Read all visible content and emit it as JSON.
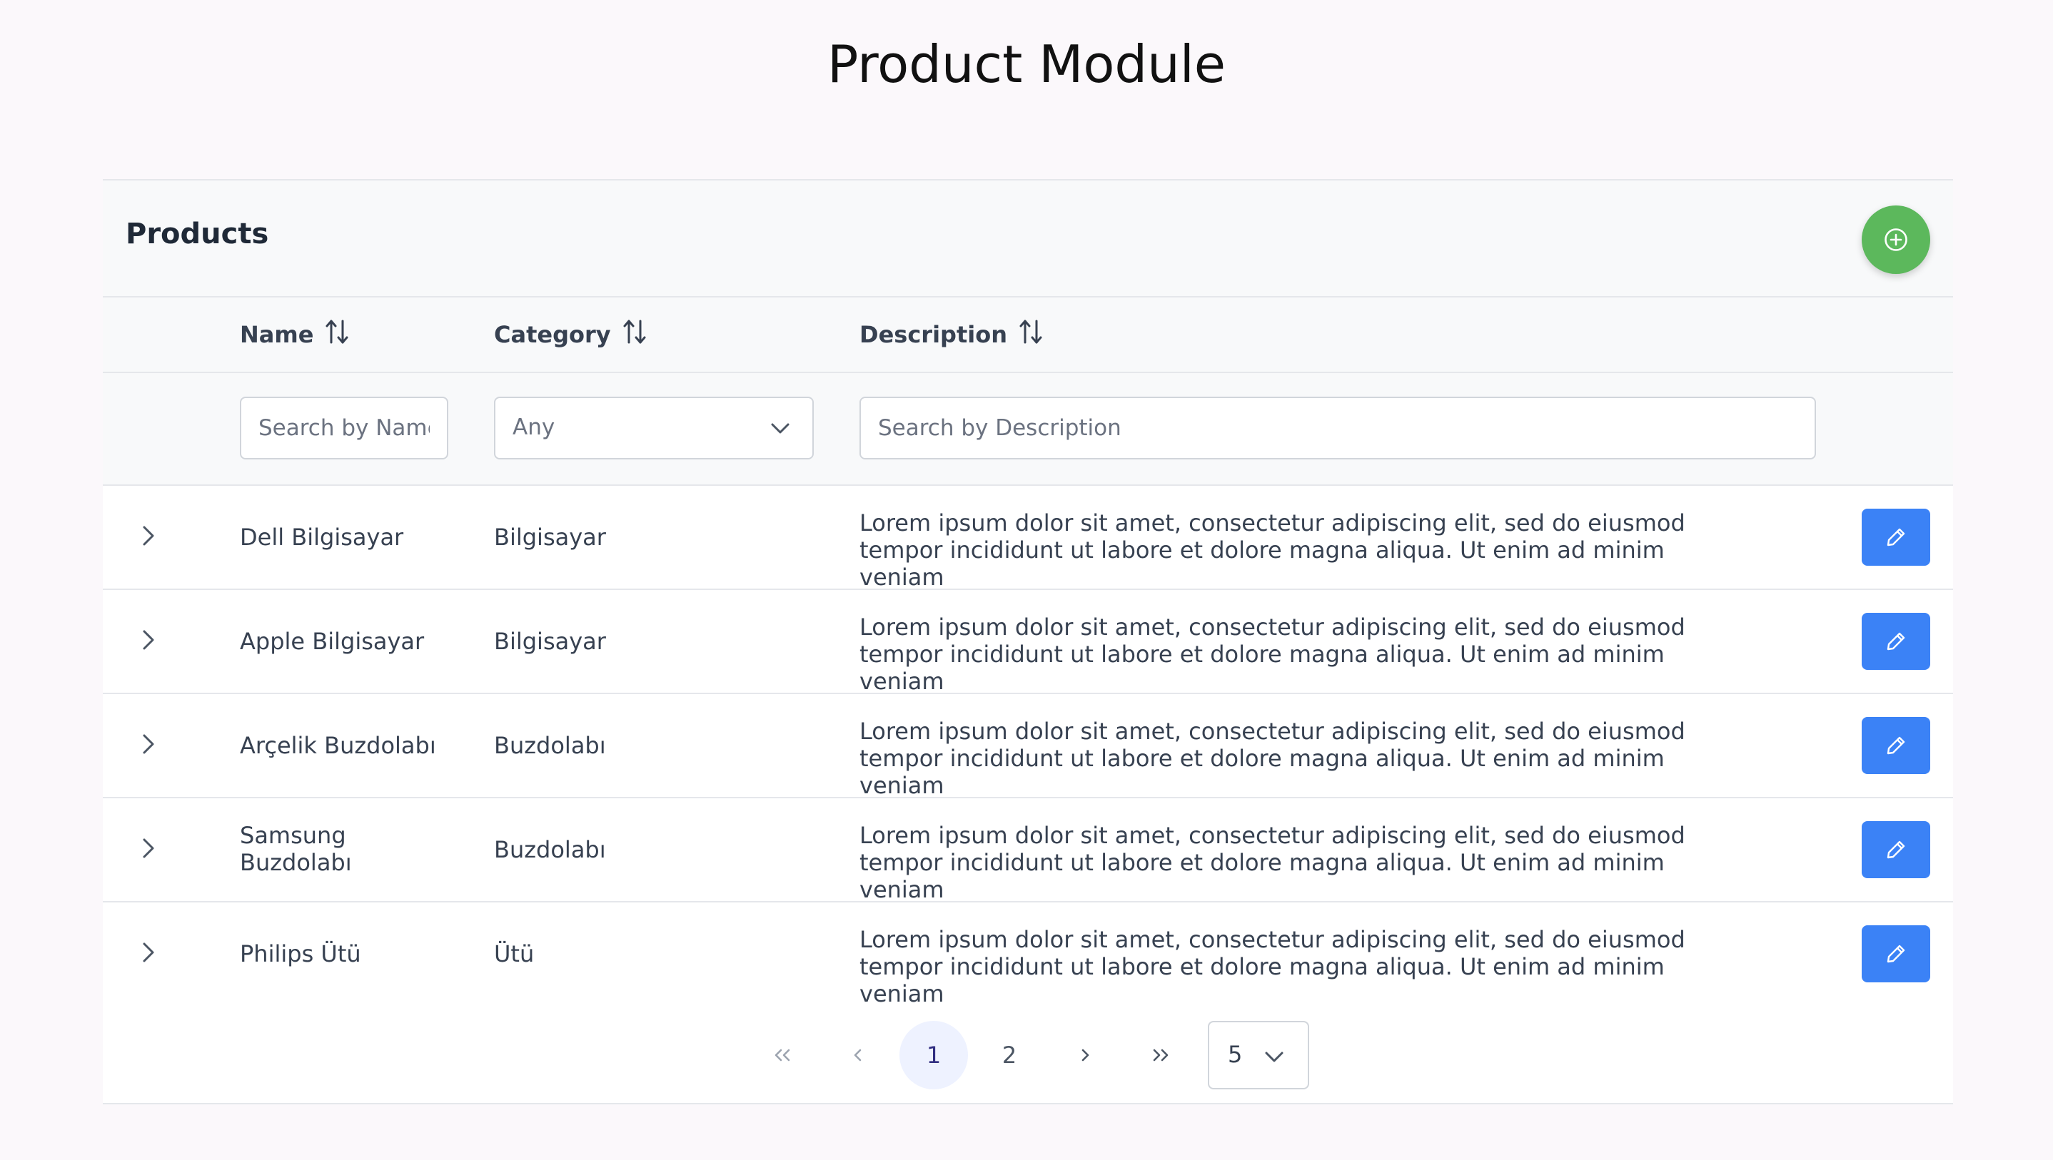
{
  "page": {
    "title": "Product Module"
  },
  "card": {
    "title": "Products"
  },
  "columns": {
    "name": "Name",
    "category": "Category",
    "description": "Description"
  },
  "filters": {
    "name_placeholder": "Search by Name",
    "category_value": "Any",
    "description_placeholder": "Search by Description"
  },
  "rows": [
    {
      "name": "Dell Bilgisayar",
      "category": "Bilgisayar",
      "description": "Lorem ipsum dolor sit amet, consectetur adipiscing elit, sed do eiusmod tempor incididunt ut labore et dolore magna aliqua. Ut enim ad minim veniam"
    },
    {
      "name": "Apple Bilgisayar",
      "category": "Bilgisayar",
      "description": "Lorem ipsum dolor sit amet, consectetur adipiscing elit, sed do eiusmod tempor incididunt ut labore et dolore magna aliqua. Ut enim ad minim veniam"
    },
    {
      "name": "Arçelik Buzdolabı",
      "category": "Buzdolabı",
      "description": "Lorem ipsum dolor sit amet, consectetur adipiscing elit, sed do eiusmod tempor incididunt ut labore et dolore magna aliqua. Ut enim ad minim veniam"
    },
    {
      "name": "Samsung Buzdolabı",
      "category": "Buzdolabı",
      "description": "Lorem ipsum dolor sit amet, consectetur adipiscing elit, sed do eiusmod tempor incididunt ut labore et dolore magna aliqua. Ut enim ad minim veniam"
    },
    {
      "name": "Philips Ütü",
      "category": "Ütü",
      "description": "Lorem ipsum dolor sit amet, consectetur adipiscing elit, sed do eiusmod tempor incididunt ut labore et dolore magna aliqua. Ut enim ad minim veniam"
    }
  ],
  "pagination": {
    "pages": [
      "1",
      "2"
    ],
    "current_page": "1",
    "rows_per_page": "5"
  },
  "colors": {
    "add_button": "#5cb85c",
    "edit_button": "#3b82f6",
    "active_page_bg": "#eef2ff"
  },
  "icons": {
    "add": "plus-circle-icon",
    "edit": "pencil-icon",
    "expand": "chevron-right-icon",
    "sort": "sort-alt-icon",
    "dropdown": "chevron-down-icon",
    "first_page": "double-chevron-left-icon",
    "prev_page": "chevron-left-icon",
    "next_page": "chevron-right-icon",
    "last_page": "double-chevron-right-icon"
  }
}
